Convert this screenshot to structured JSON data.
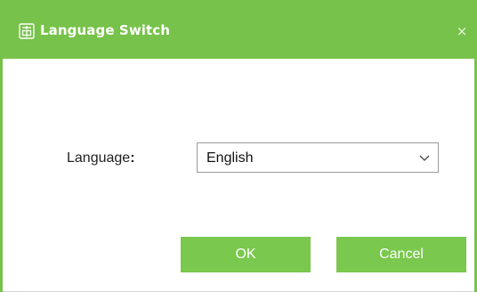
{
  "dialog": {
    "title": "Language Switch",
    "title_icon": "language-switch-icon",
    "close_label": "×",
    "accent_color": "#77c24a"
  },
  "form": {
    "language_label": "Language",
    "language_colon": ":",
    "language_selected": "English",
    "chevron_icon": "chevron-down-icon"
  },
  "buttons": {
    "ok_label": "OK",
    "cancel_label": "Cancel",
    "color": "#7ac84d"
  }
}
